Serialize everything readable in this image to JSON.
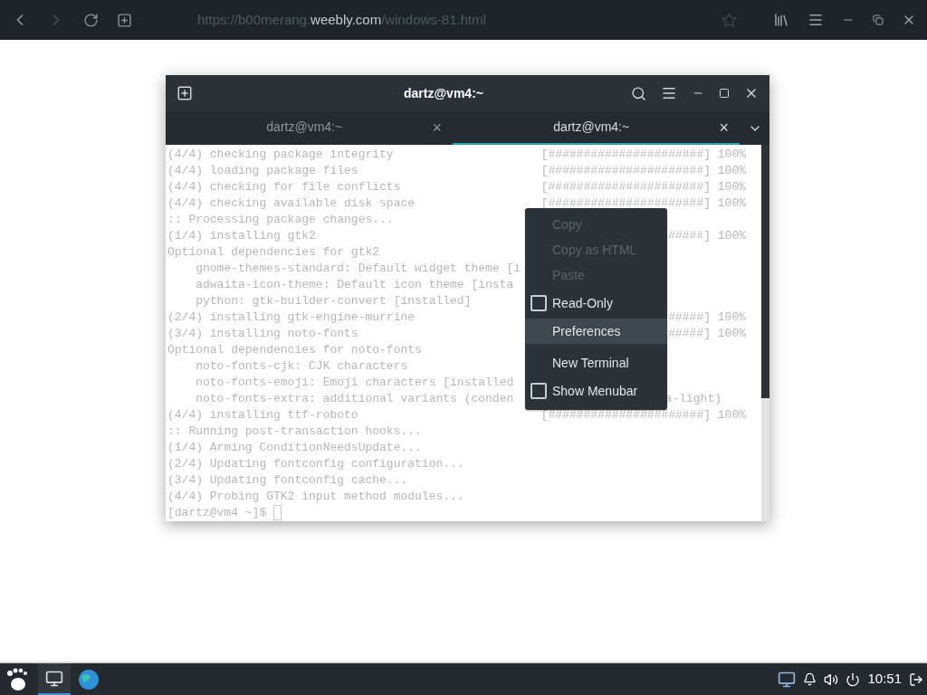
{
  "browser": {
    "url": [
      {
        "text": "https://b00merang.",
        "highlighted": false
      },
      {
        "text": "weebly.com",
        "highlighted": true
      },
      {
        "text": "/windows-81.html",
        "highlighted": false
      }
    ]
  },
  "terminal_window": {
    "title": "dartz@vm4:~",
    "tabs": [
      {
        "label": "dartz@vm4:~",
        "selected": false,
        "close": "×"
      },
      {
        "label": "dartz@vm4:~",
        "selected": true,
        "close": "×"
      }
    ],
    "lines": [
      {
        "text": "(4/4) checking package integrity",
        "right": "[######################] 100%"
      },
      {
        "text": "(4/4) loading package files",
        "right": "[######################] 100%"
      },
      {
        "text": "(4/4) checking for file conflicts",
        "right": "[######################] 100%"
      },
      {
        "text": "(4/4) checking available disk space",
        "right": "[######################] 100%"
      },
      {
        "text": ":: Processing package changes..."
      },
      {
        "text": "(1/4) installing gtk2",
        "right": "#####] 100%"
      },
      {
        "text": "Optional dependencies for gtk2"
      },
      {
        "text": "    gnome-themes-standard: Default widget theme [i"
      },
      {
        "text": "    adwaita-icon-theme: Default icon theme [insta"
      },
      {
        "text": "    python: gtk-builder-convert [installed]"
      },
      {
        "text": "(2/4) installing gtk-engine-murrine",
        "right": "#####] 100%"
      },
      {
        "text": "(3/4) installing noto-fonts",
        "right": "#####] 100%"
      },
      {
        "text": "Optional dependencies for noto-fonts"
      },
      {
        "text": "    noto-fonts-cjk: CJK characters"
      },
      {
        "text": "    noto-fonts-emoji: Emoji characters [installed"
      },
      {
        "text": "    noto-fonts-extra: additional variants (conden",
        "tail": "a-light)"
      },
      {
        "text": "(4/4) installing ttf-roboto",
        "right": "[######################] 100%"
      },
      {
        "text": ":: Running post-transaction hooks..."
      },
      {
        "text": "(1/4) Arming ConditionNeedsUpdate..."
      },
      {
        "text": "(2/4) Updating fontconfig configuration..."
      },
      {
        "text": "(3/4) Updating fontconfig cache..."
      },
      {
        "text": "(4/4) Probing GTK2 input method modules..."
      },
      {
        "text": "[dartz@vm4 ~]$ "
      }
    ]
  },
  "context_menu": [
    {
      "kind": "item",
      "label": "Copy",
      "disabled": true,
      "highlighted": false
    },
    {
      "kind": "item",
      "label": "Copy as HTML",
      "disabled": true,
      "highlighted": false
    },
    {
      "kind": "item",
      "label": "Paste",
      "disabled": true,
      "highlighted": false
    },
    {
      "kind": "check",
      "label": "Read-Only",
      "checked": false,
      "highlighted": false
    },
    {
      "kind": "item",
      "label": "Preferences",
      "disabled": false,
      "highlighted": true
    },
    {
      "kind": "separator"
    },
    {
      "kind": "item",
      "label": "New Terminal",
      "disabled": false,
      "highlighted": false
    },
    {
      "kind": "check",
      "label": "Show Menubar",
      "checked": false,
      "highlighted": false
    }
  ],
  "taskbar": {
    "clock": "10:51"
  }
}
